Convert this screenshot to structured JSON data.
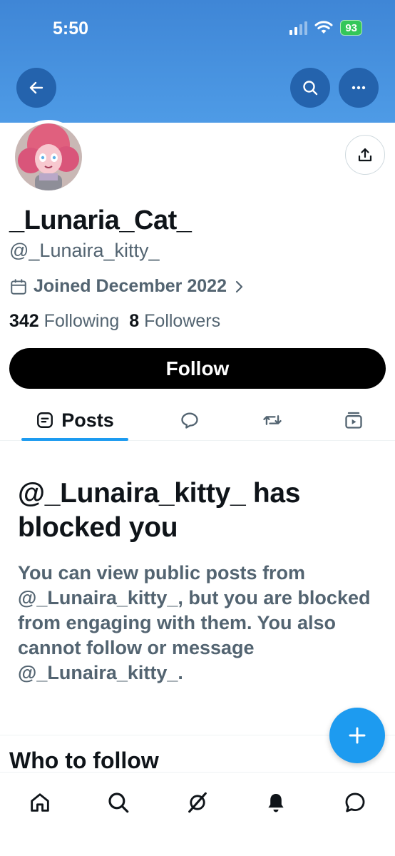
{
  "status_bar": {
    "time": "5:50",
    "battery": "93"
  },
  "profile": {
    "display_name": "_Lunaria_Cat_",
    "handle": "@_Lunaira_kitty_",
    "joined": "Joined December 2022",
    "following_count": "342",
    "following_label": "Following",
    "followers_count": "8",
    "followers_label": "Followers",
    "follow_button": "Follow"
  },
  "tabs": {
    "posts_label": "Posts"
  },
  "blocked": {
    "title": "@_Lunaira_kitty_ has blocked you",
    "body": "You can view public posts from @_Lunaira_kitty_, but you are blocked from engaging with them. You also cannot follow or message @_Lunaira_kitty_."
  },
  "who_to_follow": {
    "title": "Who to follow"
  },
  "colors": {
    "accent": "#1d9bf0",
    "header": "#4a94e0",
    "muted": "#536471",
    "battery": "#34c759"
  }
}
